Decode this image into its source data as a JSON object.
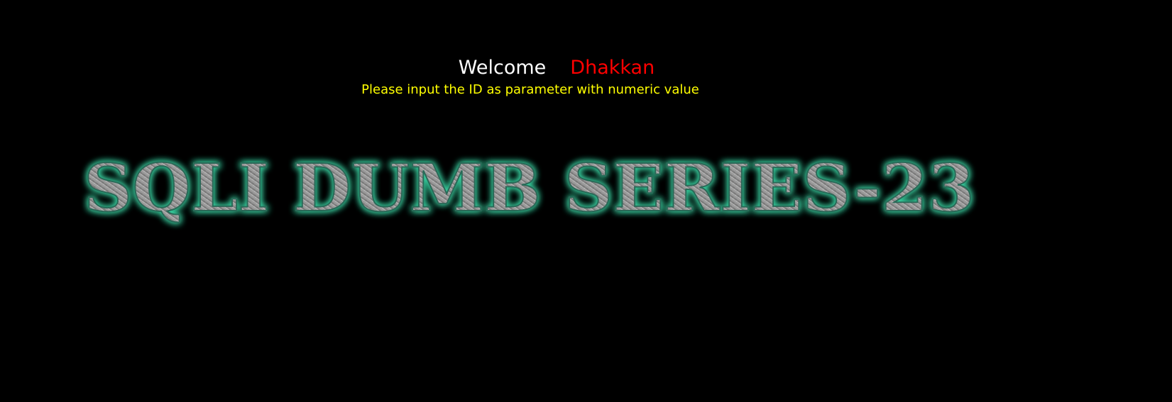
{
  "header": {
    "welcome_label": "Welcome",
    "user_name": "Dhakkan"
  },
  "instruction": {
    "text": "Please input the ID as parameter with numeric value"
  },
  "banner": {
    "title": "SQLI DUMB SERIES-23"
  },
  "colors": {
    "background": "#000000",
    "welcome": "#ffffff",
    "user_name": "#ff0000",
    "instruction": "#ffff00",
    "banner_glow": "#3ad6a4",
    "banner_metal": "#9a9a9a"
  }
}
